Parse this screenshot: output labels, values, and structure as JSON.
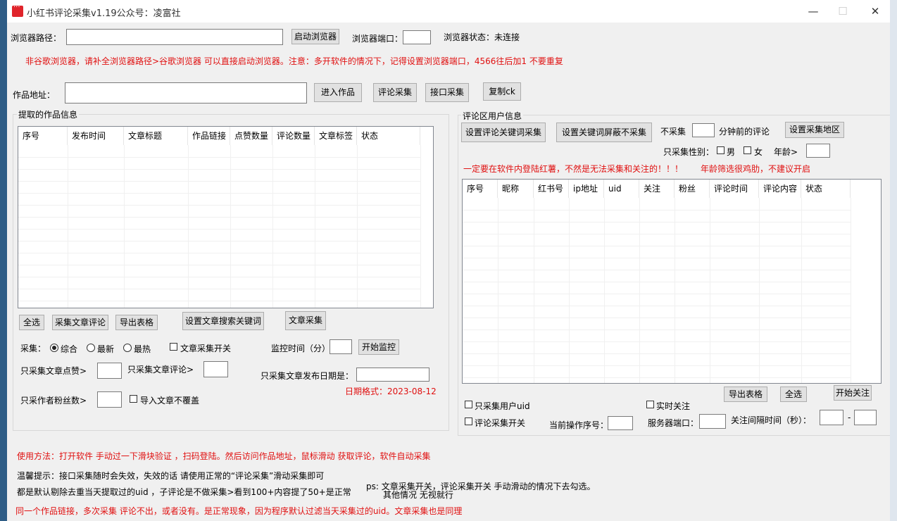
{
  "window": {
    "title": "小红书评论采集v1.19公众号：凌富社",
    "minimize": "—",
    "maximize": "☐",
    "close": "✕"
  },
  "browser": {
    "path_label": "浏览器路径：",
    "path_value": "",
    "launch_button": "启动浏览器",
    "port_label": "浏览器端口：",
    "port_value": "",
    "status_label": "浏览器状态：",
    "status_value": "未连接",
    "notice": "非谷歌浏览器，请补全浏览器路径>谷歌浏览器 可以直接启动浏览器。注意：多开软件的情况下，记得设置浏览器端口，4566往后加1  不要重复"
  },
  "work": {
    "url_label": "作品地址：",
    "url_value": "",
    "enter_button": "进入作品",
    "comment_collect_button": "评论采集",
    "api_collect_button": "接口采集",
    "copy_ck_button": "复制ck"
  },
  "left_panel": {
    "title": "提取的作品信息",
    "columns": [
      "序号",
      "发布时间",
      "文章标题",
      "作品链接",
      "点赞数量",
      "评论数量",
      "文章标签",
      "状态"
    ],
    "rows": [],
    "select_all": "全选",
    "collect_comments": "采集文章评论",
    "export": "导出表格",
    "set_keywords": "设置文章搜索关键词",
    "article_collect": "文章采集",
    "collect_label": "采集：",
    "sort_options": [
      "综合",
      "最新",
      "最热"
    ],
    "sort_selected": "综合",
    "article_switch_label": "文章采集开关",
    "article_switch_checked": false,
    "monitor_label": "监控时间（分）",
    "monitor_value": "",
    "start_monitor": "开始监控",
    "min_likes_label": "只采集文章点赞>",
    "min_likes_value": "",
    "min_comments_label": "只采集文章评论>",
    "min_comments_value": "",
    "date_label": "只采集文章发布日期是：",
    "date_value": "",
    "date_format_note": "日期格式：2023-08-12",
    "min_fans_label": "只采作者粉丝数>",
    "min_fans_value": "",
    "import_label": "导入文章不覆盖",
    "import_checked": false
  },
  "right_panel": {
    "title": "评论区用户信息",
    "set_comment_keywords": "设置评论关键词采集",
    "set_block_keywords": "设置关键词屏蔽不采集",
    "skip_label": "不采集",
    "skip_value": "",
    "skip_suffix": "分钟前的评论",
    "set_region": "设置采集地区",
    "gender_label": "只采集性别：",
    "male_label": "男",
    "female_label": "女",
    "male_checked": false,
    "female_checked": false,
    "age_label": "年龄>",
    "age_value": "",
    "warning1": "一定要在软件内登陆红薯，不然是无法采集和关注的！！！",
    "warning2": "年龄筛选很鸡肋，不建议开启",
    "columns": [
      "序号",
      "昵称",
      "红书号",
      "ip地址",
      "uid",
      "关注",
      "粉丝",
      "评论时间",
      "评论内容",
      "状态"
    ],
    "rows": [],
    "export": "导出表格",
    "select_all": "全选",
    "start_follow": "开始关注",
    "only_uid_label": "只采集用户uid",
    "only_uid_checked": false,
    "realtime_follow_label": "实时关注",
    "realtime_follow_checked": false,
    "comment_switch_label": "评论采集开关",
    "comment_switch_checked": false,
    "current_index_label": "当前操作序号：",
    "current_index_value": "",
    "server_port_label": "服务器端口：",
    "server_port_value": "",
    "interval_label": "关注间隔时间（秒）：",
    "interval_min": "",
    "interval_dash": "-",
    "interval_max": ""
  },
  "footer": {
    "usage": "使用方法：打开软件 手动过一下滑块验证  ，扫码登陆。然后访问作品地址，鼠标滑动 获取评论，软件自动采集",
    "tip1": "温馨提示：接口采集随时会失效，失效的话 请使用正常的“评论采集”滑动采集即可",
    "tip2": "都是默认剔除去重当天提取过的uid ，子评论是不做采集>看到100+内容提了50+是正常",
    "ps_line1": "ps: 文章采集开关，评论采集开关 手动滑动的情况下去勾选。",
    "ps_line2": "其他情况 无视就行",
    "tip3": "同一个作品链接，多次采集  评论不出，或者没有。是正常现象，因为程序默认过滤当天采集过的uid。文章采集也是同理"
  }
}
